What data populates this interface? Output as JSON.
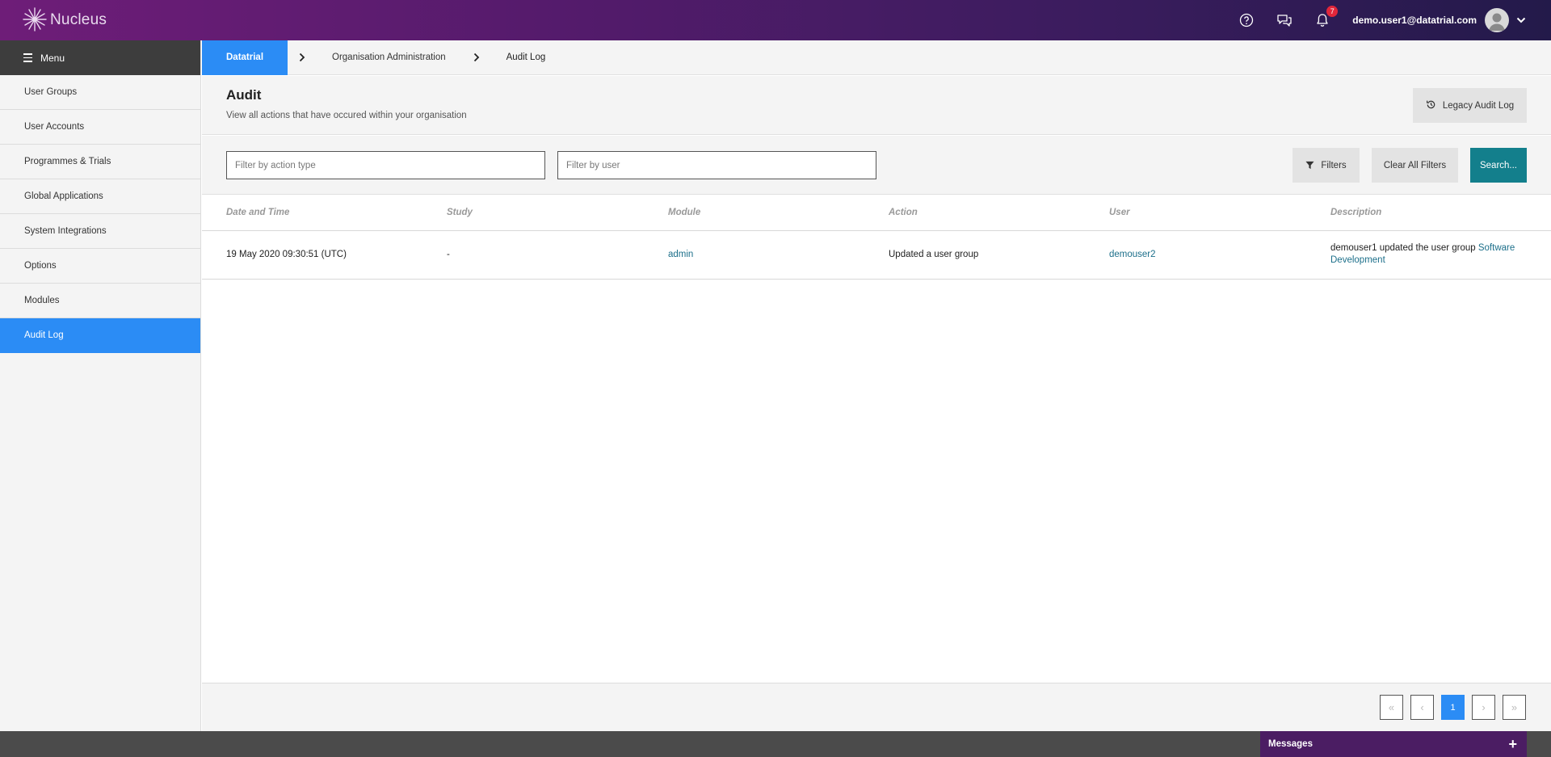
{
  "topbar": {
    "app_name": "Nucleus",
    "notification_count": "7",
    "user_email": "demo.user1@datatrial.com"
  },
  "sidebar": {
    "menu_label": "Menu",
    "items": [
      {
        "label": "User Groups"
      },
      {
        "label": "User Accounts"
      },
      {
        "label": "Programmes & Trials"
      },
      {
        "label": "Global Applications"
      },
      {
        "label": "System Integrations"
      },
      {
        "label": "Options"
      },
      {
        "label": "Modules"
      },
      {
        "label": "Audit Log",
        "active": true
      }
    ]
  },
  "breadcrumb": {
    "items": [
      "Datatrial",
      "Organisation Administration",
      "Audit Log"
    ]
  },
  "page": {
    "title": "Audit",
    "subtitle": "View all actions that have occured within your organisation",
    "legacy_button": "Legacy Audit Log"
  },
  "filters": {
    "action_placeholder": "Filter by action type",
    "user_placeholder": "Filter by user",
    "filters_button": "Filters",
    "clear_button": "Clear All Filters",
    "search_button": "Search..."
  },
  "table": {
    "columns": [
      "Date and Time",
      "Study",
      "Module",
      "Action",
      "User",
      "Description"
    ],
    "rows": [
      {
        "datetime": "19 May 2020 09:30:51 (UTC)",
        "study": "-",
        "module": "admin",
        "action": "Updated a user group",
        "user": "demouser2",
        "description_prefix": "demouser1 updated the user group ",
        "description_link": "Software Development"
      }
    ]
  },
  "pagination": {
    "first": "«",
    "prev": "‹",
    "current": "1",
    "next": "›",
    "last": "»"
  },
  "footer": {
    "messages_label": "Messages",
    "messages_toggle": "+"
  },
  "colors": {
    "accent_blue": "#2b8cf5",
    "teal": "#137f8c",
    "link": "#1c6f8a",
    "topbar_start": "#6e1d78",
    "topbar_end": "#231a4a"
  }
}
